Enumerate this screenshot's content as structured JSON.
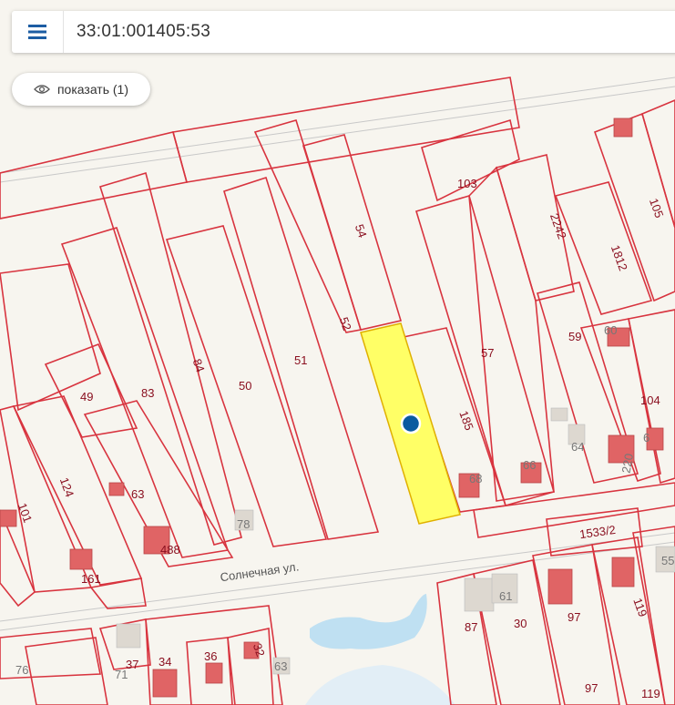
{
  "search": {
    "query": "33:01:001405:53"
  },
  "show_button": {
    "label": "показать (1)",
    "icon": "eye-icon"
  },
  "menu": {
    "icon": "hamburger-menu-icon"
  },
  "map": {
    "street_names": [
      "Солнечная ул."
    ],
    "selected_parcel_color": "#ffff66",
    "marker_color": "#0a5aa0",
    "parcel_labels": [
      "103",
      "2242",
      "105",
      "1812",
      "54",
      "52",
      "51",
      "84",
      "83",
      "50",
      "49",
      "57",
      "59",
      "185",
      "104",
      "124",
      "101",
      "63",
      "488",
      "161",
      "1533/2",
      "119",
      "97",
      "87",
      "30",
      "37",
      "34",
      "36",
      "32",
      "97",
      "119"
    ],
    "building_labels": [
      "60",
      "68",
      "66",
      "64",
      "6",
      "220",
      "78",
      "61",
      "55",
      "76",
      "71",
      "63"
    ]
  }
}
